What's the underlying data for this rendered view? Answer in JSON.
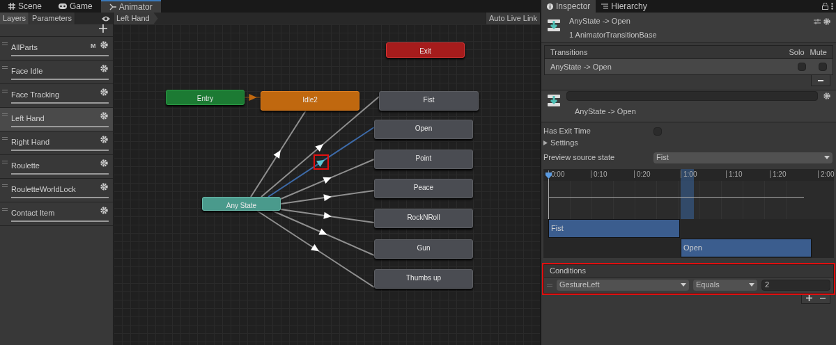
{
  "editor_tabs": [
    {
      "label": "Scene",
      "selected": false
    },
    {
      "label": "Game",
      "selected": false
    },
    {
      "label": "Animator",
      "selected": true
    }
  ],
  "left_tabs": [
    {
      "label": "Layers",
      "selected": true
    },
    {
      "label": "Parameters",
      "selected": false
    }
  ],
  "layers": [
    {
      "name": "AllParts",
      "badge": "M",
      "selected": false
    },
    {
      "name": "Face Idle",
      "selected": false
    },
    {
      "name": "Face Tracking",
      "selected": false
    },
    {
      "name": "Left Hand",
      "selected": true
    },
    {
      "name": "Right Hand",
      "selected": false
    },
    {
      "name": "Roulette",
      "selected": false
    },
    {
      "name": "RouletteWorldLock",
      "selected": false
    },
    {
      "name": "Contact Item",
      "selected": false
    }
  ],
  "breadcrumb": "Left Hand",
  "auto_live_link": "Auto Live Link",
  "nodes": [
    {
      "label": "Exit",
      "kind": "exit"
    },
    {
      "label": "Entry",
      "kind": "entry"
    },
    {
      "label": "Idle2",
      "kind": "default"
    },
    {
      "label": "Fist",
      "kind": "state"
    },
    {
      "label": "Open",
      "kind": "state"
    },
    {
      "label": "Point",
      "kind": "state"
    },
    {
      "label": "Peace",
      "kind": "state"
    },
    {
      "label": "RockNRoll",
      "kind": "state"
    },
    {
      "label": "Gun",
      "kind": "state"
    },
    {
      "label": "Thumbs up",
      "kind": "state"
    },
    {
      "label": "Any State",
      "kind": "any"
    }
  ],
  "transitions": [
    {
      "selected": false
    },
    {
      "selected": false
    },
    {
      "selected": true,
      "highlighted": true
    },
    {
      "selected": false
    },
    {
      "selected": false
    },
    {
      "selected": false
    },
    {
      "selected": false
    },
    {
      "selected": false
    }
  ],
  "inspector_tabs": [
    {
      "label": "Inspector",
      "selected": true
    },
    {
      "label": "Hierarchy",
      "selected": false
    }
  ],
  "header": {
    "title": "AnyState -> Open",
    "subtitle": "1 AnimatorTransitionBase"
  },
  "transitions_list": {
    "title": "Transitions",
    "solo": "Solo",
    "mute": "Mute",
    "rows": [
      {
        "name": "AnyState -> Open",
        "solo": false,
        "mute": false
      }
    ]
  },
  "transition_name": "AnyState -> Open",
  "has_exit_time": {
    "label": "Has Exit Time",
    "checked": false
  },
  "settings": {
    "label": "Settings",
    "expanded": false
  },
  "preview": {
    "label": "Preview source state",
    "value": "Fist"
  },
  "timeline": {
    "ticks": [
      "0:00",
      "0:10",
      "0:20",
      "1:00",
      "1:10",
      "1:20",
      "2:00"
    ],
    "clips": [
      {
        "name": "Fist"
      },
      {
        "name": "Open"
      }
    ]
  },
  "conditions": {
    "title": "Conditions",
    "highlighted": true,
    "rows": [
      {
        "parameter": "GestureLeft",
        "mode": "Equals",
        "value": "2"
      }
    ]
  }
}
